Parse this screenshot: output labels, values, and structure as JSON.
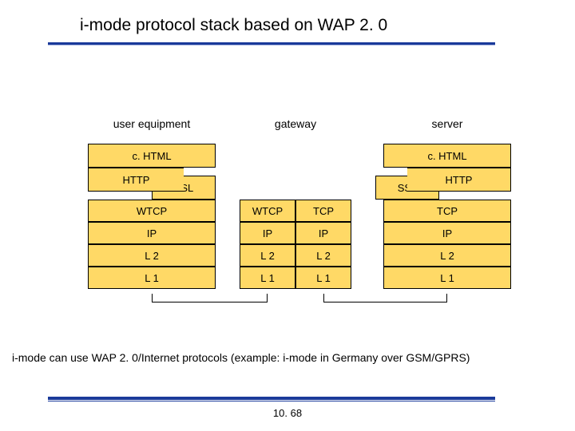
{
  "title": "i-mode protocol stack based on WAP 2. 0",
  "columns": {
    "ue": "user equipment",
    "gw": "gateway",
    "srv": "server"
  },
  "layers": {
    "chtml": "c. HTML",
    "http": "HTTP",
    "ssl": "SSL",
    "wtcp": "WTCP",
    "tcp": "TCP",
    "ip": "IP",
    "l2": "L 2",
    "l1": "L 1"
  },
  "caption": "i-mode can use WAP 2. 0/Internet protocols (example: i-mode in Germany over GSM/GPRS)",
  "slide_number": "10. 68"
}
